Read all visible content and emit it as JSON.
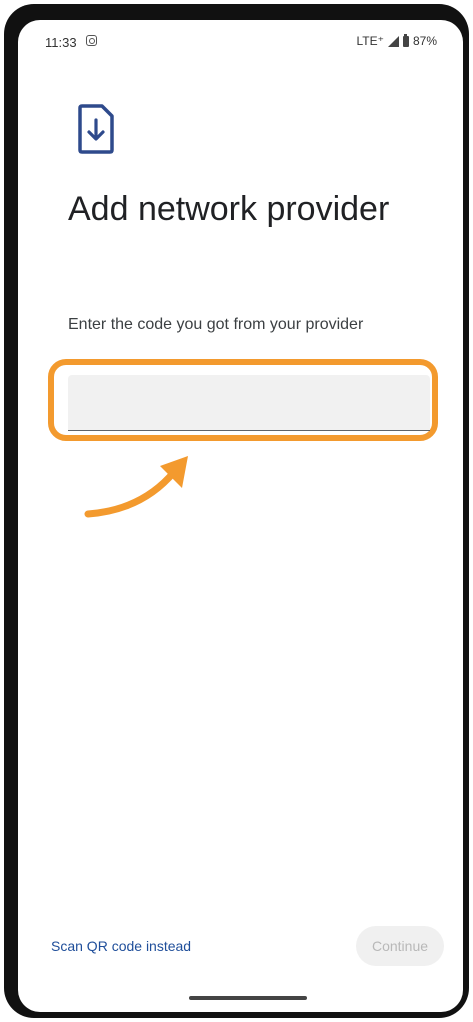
{
  "status_bar": {
    "time": "11:33",
    "network": "LTE⁺",
    "battery": "87%",
    "icons": [
      "instagram-icon",
      "signal-icon",
      "battery-icon"
    ]
  },
  "main": {
    "icon": "sim-download-icon",
    "title": "Add network provider",
    "instruction": "Enter the code you got from your provider",
    "code_input": {
      "value": "",
      "placeholder": ""
    }
  },
  "footer": {
    "scan_qr_label": "Scan QR code instead",
    "continue_label": "Continue"
  },
  "colors": {
    "annotation_orange": "#f39a2e",
    "icon_blue": "#2e4a8c",
    "link_blue": "#1f4e9a",
    "disabled_text": "#b8b8b8"
  }
}
